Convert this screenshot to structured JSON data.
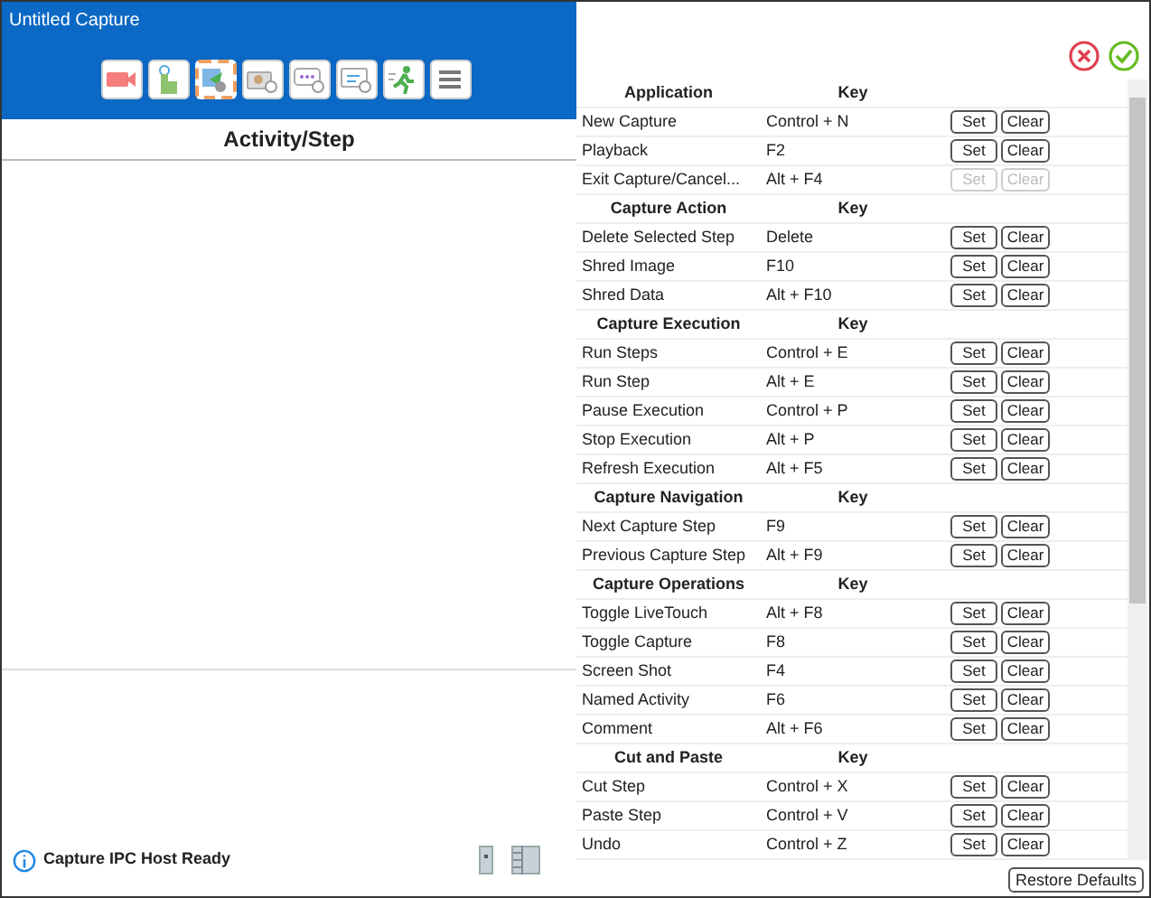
{
  "window": {
    "title": "Untitled Capture"
  },
  "toolbar": [
    {
      "kind": "record",
      "selected": false
    },
    {
      "kind": "touch",
      "selected": false
    },
    {
      "kind": "select",
      "selected": true
    },
    {
      "kind": "camera",
      "selected": false
    },
    {
      "kind": "comment",
      "selected": false
    },
    {
      "kind": "note",
      "selected": false
    },
    {
      "kind": "run",
      "selected": false
    },
    {
      "kind": "menu",
      "selected": false
    }
  ],
  "activity_header": "Activity/Step",
  "status": {
    "text": "Capture IPC Host Ready"
  },
  "shortcuts": {
    "sections": [
      {
        "title": "Application",
        "key_header": "Key",
        "rows": [
          {
            "action": "New Capture",
            "key": "Control + N",
            "set": "Set",
            "clear": "Clear",
            "disabled": false
          },
          {
            "action": "Playback",
            "key": "F2",
            "set": "Set",
            "clear": "Clear",
            "disabled": false
          },
          {
            "action": "Exit Capture/Cancel...",
            "key": "Alt + F4",
            "set": "Set",
            "clear": "Clear",
            "disabled": true
          }
        ]
      },
      {
        "title": "Capture Action",
        "key_header": "Key",
        "rows": [
          {
            "action": "Delete Selected Step",
            "key": "Delete",
            "set": "Set",
            "clear": "Clear",
            "disabled": false
          },
          {
            "action": "Shred Image",
            "key": "F10",
            "set": "Set",
            "clear": "Clear",
            "disabled": false
          },
          {
            "action": "Shred Data",
            "key": "Alt + F10",
            "set": "Set",
            "clear": "Clear",
            "disabled": false
          }
        ]
      },
      {
        "title": "Capture Execution",
        "key_header": "Key",
        "rows": [
          {
            "action": "Run Steps",
            "key": "Control + E",
            "set": "Set",
            "clear": "Clear",
            "disabled": false
          },
          {
            "action": "Run Step",
            "key": "Alt + E",
            "set": "Set",
            "clear": "Clear",
            "disabled": false
          },
          {
            "action": "Pause Execution",
            "key": "Control + P",
            "set": "Set",
            "clear": "Clear",
            "disabled": false
          },
          {
            "action": "Stop Execution",
            "key": "Alt + P",
            "set": "Set",
            "clear": "Clear",
            "disabled": false
          },
          {
            "action": "Refresh Execution",
            "key": "Alt + F5",
            "set": "Set",
            "clear": "Clear",
            "disabled": false
          }
        ]
      },
      {
        "title": "Capture Navigation",
        "key_header": "Key",
        "rows": [
          {
            "action": "Next Capture Step",
            "key": "F9",
            "set": "Set",
            "clear": "Clear",
            "disabled": false
          },
          {
            "action": "Previous Capture Step",
            "key": "Alt + F9",
            "set": "Set",
            "clear": "Clear",
            "disabled": false
          }
        ]
      },
      {
        "title": "Capture Operations",
        "key_header": "Key",
        "rows": [
          {
            "action": "Toggle LiveTouch",
            "key": "Alt + F8",
            "set": "Set",
            "clear": "Clear",
            "disabled": false
          },
          {
            "action": "Toggle Capture",
            "key": "F8",
            "set": "Set",
            "clear": "Clear",
            "disabled": false
          },
          {
            "action": "Screen Shot",
            "key": "F4",
            "set": "Set",
            "clear": "Clear",
            "disabled": false
          },
          {
            "action": "Named Activity",
            "key": "F6",
            "set": "Set",
            "clear": "Clear",
            "disabled": false
          },
          {
            "action": "Comment",
            "key": "Alt + F6",
            "set": "Set",
            "clear": "Clear",
            "disabled": false
          }
        ]
      },
      {
        "title": "Cut and Paste",
        "key_header": "Key",
        "rows": [
          {
            "action": "Cut Step",
            "key": "Control + X",
            "set": "Set",
            "clear": "Clear",
            "disabled": false
          },
          {
            "action": "Paste Step",
            "key": "Control + V",
            "set": "Set",
            "clear": "Clear",
            "disabled": false
          },
          {
            "action": "Undo",
            "key": "Control + Z",
            "set": "Set",
            "clear": "Clear",
            "disabled": false
          }
        ]
      }
    ],
    "restore_label": "Restore Defaults"
  }
}
